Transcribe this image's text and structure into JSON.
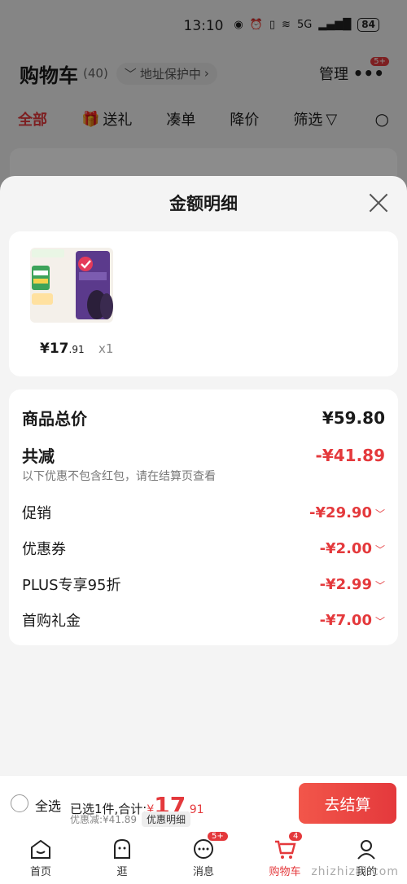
{
  "status_bar": {
    "time": "13:10",
    "network": "5G",
    "battery": "84"
  },
  "cart_header": {
    "title": "购物车",
    "count": "(40)",
    "address_pill": "地址保护中",
    "manage": "管理",
    "more_badge": "5+"
  },
  "filters": {
    "items": [
      "全部",
      "送礼",
      "凑单",
      "降价",
      "筛选"
    ]
  },
  "sheet": {
    "title": "金额明细",
    "product": {
      "price_int": "¥17",
      "price_dec": ".91",
      "qty": "x1"
    },
    "rows": {
      "total_label": "商品总价",
      "total_value": "¥59.80",
      "reduce_label": "共减",
      "reduce_value": "-¥41.89",
      "note": "以下优惠不包含红包，请在结算页查看",
      "promo_label": "促销",
      "promo_value": "-¥29.90",
      "coupon_label": "优惠券",
      "coupon_value": "-¥2.00",
      "plus_label": "PLUS专享95折",
      "plus_value": "-¥2.99",
      "first_label": "首购礼金",
      "first_value": "-¥7.00"
    }
  },
  "bottom_bar": {
    "select_all": "全选",
    "summary_prefix": "已选1件,合计:",
    "yen": "¥",
    "price_int": "17",
    "price_dec": ".91",
    "discount": "优惠减:¥41.89",
    "detail_pill": "优惠明细",
    "checkout": "去结算"
  },
  "tabs": [
    {
      "label": "首页"
    },
    {
      "label": "逛"
    },
    {
      "label": "消息",
      "badge": "5+"
    },
    {
      "label": "购物车",
      "badge": "4"
    },
    {
      "label": "我的"
    }
  ],
  "watermark": "zhizhizhi.com",
  "colors": {
    "accent": "#e4393c"
  }
}
